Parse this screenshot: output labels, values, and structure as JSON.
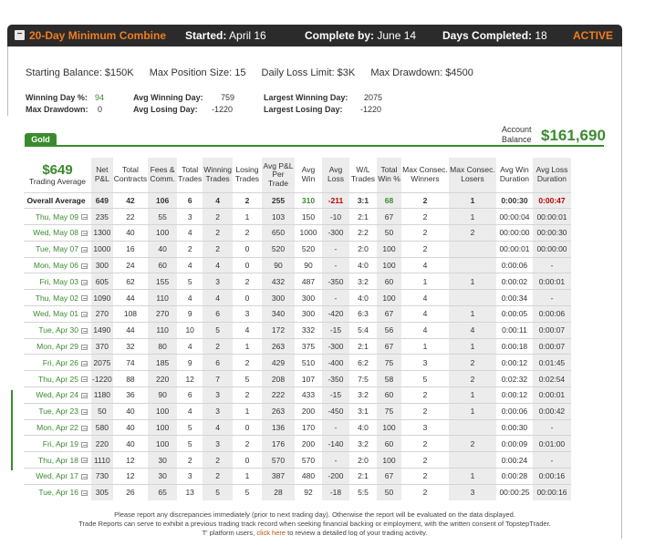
{
  "header": {
    "collapse_icon": "−",
    "title": "20-Day Minimum Combine",
    "started_label": "Started:",
    "started_value": "April 16",
    "complete_label": "Complete by:",
    "complete_value": "June 14",
    "days_label": "Days Completed:",
    "days_value": "18",
    "status": "ACTIVE"
  },
  "summary": {
    "starting_balance": "Starting Balance: $150K",
    "max_position": "Max Position Size: 15",
    "daily_loss": "Daily Loss Limit: $3K",
    "max_drawdown": "Max Drawdown: $4500"
  },
  "stats": {
    "winning_day_label": "Winning Day %:",
    "winning_day_value": "94",
    "max_drawdown_label": "Max Drawdown:",
    "max_drawdown_value": "0",
    "avg_winning_label": "Avg Winning Day:",
    "avg_winning_value": "759",
    "avg_losing_label": "Avg Losing Day:",
    "avg_losing_value": "-1220",
    "largest_winning_label": "Largest Winning Day:",
    "largest_winning_value": "2075",
    "largest_losing_label": "Largest Losing Day:",
    "largest_losing_value": "-1220"
  },
  "tier": "Gold",
  "account": {
    "label_line1": "Account",
    "label_line2": "Balance",
    "value": "$161,690"
  },
  "table": {
    "trading_average_value": "$649",
    "trading_average_label": "Trading Average",
    "columns": [
      [
        "Net",
        "P&L"
      ],
      [
        "Total",
        "Contracts"
      ],
      [
        "Fees &",
        "Comm."
      ],
      [
        "Total",
        "Trades"
      ],
      [
        "Winning",
        "Trades"
      ],
      [
        "Losing",
        "Trades"
      ],
      [
        "Avg P&L",
        "Per",
        "Trade"
      ],
      [
        "Avg",
        "Win"
      ],
      [
        "Avg",
        "Loss"
      ],
      [
        "W/L",
        "Trades"
      ],
      [
        "Total",
        "Win %"
      ],
      [
        "Max Consec.",
        "Winners"
      ],
      [
        "Max Consec.",
        "Losers"
      ],
      [
        "Avg Win",
        "Duration"
      ],
      [
        "Avg Loss",
        "Duration"
      ]
    ],
    "overall": {
      "label": "Overall Average",
      "cells": [
        "649",
        "42",
        "106",
        "6",
        "4",
        "2",
        "255",
        "310",
        "-211",
        "3:1",
        "68",
        "2",
        "1",
        "0:00:30",
        "0:00:47"
      ]
    },
    "rows": [
      {
        "date": "Thu, May 09",
        "cells": [
          "235",
          "22",
          "55",
          "3",
          "2",
          "1",
          "103",
          "150",
          "-10",
          "2:1",
          "67",
          "2",
          "1",
          "00:00:04",
          "00:00:01"
        ]
      },
      {
        "date": "Wed, May 08",
        "cells": [
          "1300",
          "40",
          "100",
          "4",
          "2",
          "2",
          "650",
          "1000",
          "-300",
          "2:2",
          "50",
          "2",
          "2",
          "00:00:00",
          "00:00:30"
        ]
      },
      {
        "date": "Tue, May 07",
        "cells": [
          "1000",
          "16",
          "40",
          "2",
          "2",
          "0",
          "520",
          "520",
          "-",
          "2:0",
          "100",
          "2",
          "",
          "00:00:01",
          "00:00:00"
        ]
      },
      {
        "date": "Mon, May 06",
        "cells": [
          "300",
          "24",
          "60",
          "4",
          "4",
          "0",
          "90",
          "90",
          "-",
          "4:0",
          "100",
          "4",
          "",
          "0:00:06",
          "-"
        ]
      },
      {
        "date": "Fri, May 03",
        "cells": [
          "605",
          "62",
          "155",
          "5",
          "3",
          "2",
          "432",
          "487",
          "-350",
          "3:2",
          "60",
          "1",
          "1",
          "0:00:02",
          "0:00:01"
        ]
      },
      {
        "date": "Thu, May 02",
        "cells": [
          "1090",
          "44",
          "110",
          "4",
          "4",
          "0",
          "300",
          "300",
          "-",
          "4:0",
          "100",
          "4",
          "",
          "0:00:34",
          "-"
        ]
      },
      {
        "date": "Wed, May 01",
        "cells": [
          "270",
          "108",
          "270",
          "9",
          "6",
          "3",
          "340",
          "300",
          "-420",
          "6:3",
          "67",
          "4",
          "1",
          "0:00:05",
          "0:00:06"
        ]
      },
      {
        "date": "Tue, Apr 30",
        "cells": [
          "1490",
          "44",
          "110",
          "10",
          "5",
          "4",
          "172",
          "332",
          "-15",
          "5:4",
          "56",
          "4",
          "4",
          "0:00:11",
          "0:00:07"
        ]
      },
      {
        "date": "Mon, Apr 29",
        "cells": [
          "370",
          "32",
          "80",
          "4",
          "2",
          "1",
          "263",
          "375",
          "-300",
          "2:1",
          "67",
          "1",
          "1",
          "0:00:18",
          "0:00:07"
        ]
      },
      {
        "date": "Fri, Apr 26",
        "cells": [
          "2075",
          "74",
          "185",
          "9",
          "6",
          "2",
          "429",
          "510",
          "-400",
          "6:2",
          "75",
          "3",
          "2",
          "0:00:12",
          "0:01:45"
        ]
      },
      {
        "date": "Thu, Apr 25",
        "cells": [
          "-1220",
          "88",
          "220",
          "12",
          "7",
          "5",
          "208",
          "107",
          "-350",
          "7:5",
          "58",
          "5",
          "2",
          "0:02:32",
          "0:02:54"
        ]
      },
      {
        "date": "Wed, Apr 24",
        "cells": [
          "1180",
          "36",
          "90",
          "6",
          "3",
          "2",
          "222",
          "433",
          "-15",
          "3:2",
          "60",
          "2",
          "1",
          "0:00:12",
          "0:00:01"
        ]
      },
      {
        "date": "Tue, Apr 23",
        "cells": [
          "50",
          "40",
          "100",
          "4",
          "3",
          "1",
          "263",
          "200",
          "-450",
          "3:1",
          "75",
          "2",
          "1",
          "0:00:06",
          "0:00:42"
        ]
      },
      {
        "date": "Mon, Apr 22",
        "cells": [
          "580",
          "40",
          "100",
          "5",
          "4",
          "0",
          "136",
          "170",
          "-",
          "4:0",
          "100",
          "3",
          "",
          "0:00:30",
          "-"
        ]
      },
      {
        "date": "Fri, Apr 19",
        "cells": [
          "220",
          "40",
          "100",
          "5",
          "3",
          "2",
          "176",
          "200",
          "-140",
          "3:2",
          "60",
          "2",
          "2",
          "0:00:09",
          "0:01:00"
        ]
      },
      {
        "date": "Thu, Apr 18",
        "cells": [
          "1110",
          "12",
          "30",
          "2",
          "2",
          "0",
          "570",
          "570",
          "-",
          "2:0",
          "100",
          "2",
          "",
          "0:00:24",
          "-"
        ]
      },
      {
        "date": "Wed, Apr 17",
        "cells": [
          "730",
          "12",
          "30",
          "3",
          "2",
          "1",
          "387",
          "480",
          "-200",
          "2:1",
          "67",
          "2",
          "1",
          "0:00:28",
          "0:00:16"
        ]
      },
      {
        "date": "Tue, Apr 16",
        "cells": [
          "305",
          "26",
          "65",
          "13",
          "5",
          "5",
          "28",
          "92",
          "-18",
          "5:5",
          "50",
          "2",
          "3",
          "00:00:25",
          "00:00:16"
        ]
      }
    ]
  },
  "footer": {
    "line1": "Please report any discrepancies immediately (prior to next trading day). Otherwise the report will be evaluated on the data displayed.",
    "line2": "Trade Reports can serve to exhibit a previous trading track record when seeking financial backing or employment, with the written consent of TopstepTrader.",
    "line3_pre": "T' platform users,",
    "line3_link": "click here",
    "line3_post": "to review a detailed log of your trading activity."
  }
}
